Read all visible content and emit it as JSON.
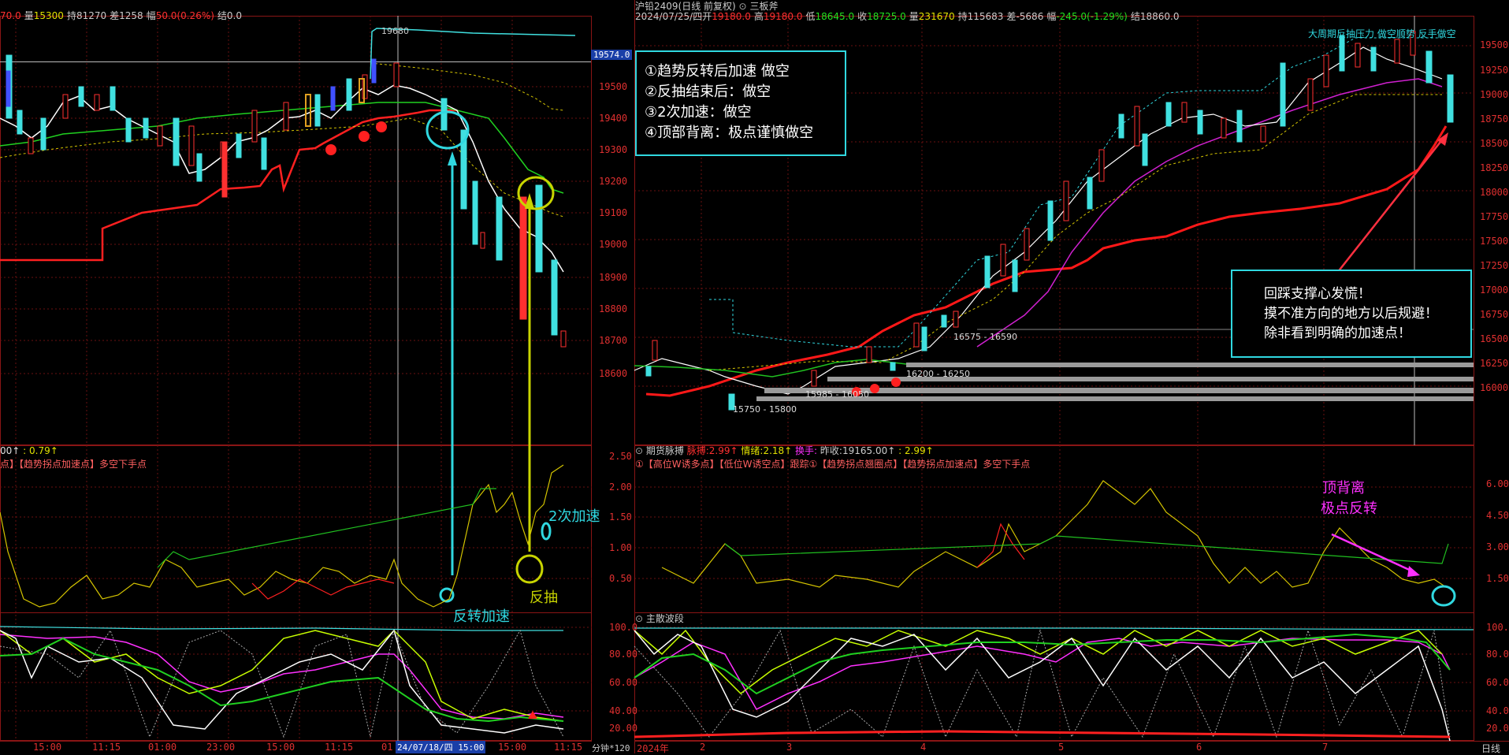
{
  "left": {
    "header": {
      "price_prefix": "70.0",
      "volume_label": "量",
      "volume": "15300",
      "oi_label": "持",
      "oi": "81270",
      "diff_label": "差",
      "diff": "1258",
      "change_label": "幅",
      "change": "50.0(0.26%)",
      "settle_label": "结",
      "settle": "0.0"
    },
    "peak_label": "19680",
    "current_price_tag": "19574.0",
    "y_axis": [
      "19500",
      "19400",
      "19300",
      "19200",
      "19100",
      "19000",
      "18900",
      "18800",
      "18700",
      "18600"
    ],
    "annotations": {
      "box_lines": [
        "①趋势反转后加速 做空",
        "②反抽结束后：做空",
        "③2次加速：做空",
        "④顶部背离：极点谨慎做空"
      ],
      "second_accel": "2次加速",
      "pullback": "反抽",
      "reversal_accel": "反转加速"
    },
    "ind1": {
      "value_label": "00↑",
      "value2": ": 0.79↑",
      "legend": "点】【趋势拐点加速点】多空下手点",
      "y_axis": [
        "2.50",
        "2.00",
        "1.50",
        "1.00",
        "0.50"
      ]
    },
    "ind2": {
      "y_axis": [
        "100.0",
        "80.00",
        "60.00",
        "40.00",
        "20.00"
      ]
    },
    "x_axis": [
      "15:00",
      "11:15",
      "01:00",
      "23:00",
      "15:00",
      "11:15",
      "01",
      "24/07/18/四 15:00",
      "15:00",
      "11:15"
    ],
    "x_label": "分钟*120"
  },
  "right": {
    "header_line1": {
      "name": "沪铅2409(日线 前复权)",
      "indicator": "三板斧"
    },
    "header_line2": {
      "date": "2024/07/25/四",
      "open_label": "开",
      "open": "19180.0",
      "high_label": "高",
      "high": "19180.0",
      "low_label": "低",
      "low": "18645.0",
      "close_label": "收",
      "close": "18725.0",
      "vol_label": "量",
      "vol": "231670",
      "oi_label": "持",
      "oi": "115683",
      "diff_label": "差",
      "diff": "-5686",
      "chg_label": "幅",
      "chg": "-245.0(-1.29%)",
      "settle_label": "结",
      "settle": "18860.0"
    },
    "top_note": "大周期反抽压力 做空顺势 反手做空",
    "y_axis": [
      "19500",
      "19250",
      "19000",
      "18750",
      "18500",
      "18250",
      "18000",
      "17750",
      "17500",
      "17250",
      "17000",
      "16750",
      "16500",
      "16250",
      "16000"
    ],
    "zone_labels": [
      "16575 - 16590",
      "16200 - 16250",
      "15985 - 16050",
      "15750 - 15800"
    ],
    "annotation_box": [
      "回踩支撑心发慌！",
      "摸不准方向的地方以后规避！",
      "除非看到明确的加速点！"
    ],
    "ind1": {
      "title": "期货脉搏",
      "pulse_label": "脉搏:",
      "pulse": "2.99↑",
      "mood_label": "情绪:",
      "mood": "2.18↑",
      "turn_label": "换手:",
      "turn": "",
      "prev_label": "昨收:",
      "prev": "19165.00↑",
      "extra": ": 2.99↑",
      "legend": "①【高位W诱多点】【低位W诱空点】跟踪①【趋势拐点翘圈点】【趋势拐点加速点】多空下手点",
      "y_axis": [
        "6.00",
        "4.50",
        "3.00",
        "1.50"
      ],
      "note_line1": "顶背离",
      "note_line2": "极点反转"
    },
    "ind2": {
      "title": "主散波段",
      "y_axis": [
        "100.0",
        "80.00",
        "60.00",
        "40.00",
        "20.00"
      ]
    },
    "x_axis": [
      "2024年",
      "2",
      "3",
      "4",
      "5",
      "6",
      "7"
    ],
    "x_label": "日线"
  },
  "colors": {
    "up": "#ff3030",
    "down": "#40e0e0",
    "grid": "#6a1010",
    "accent_cyan": "#30d8e0",
    "accent_yellow": "#d4d400",
    "magenta": "#ff30ff"
  }
}
